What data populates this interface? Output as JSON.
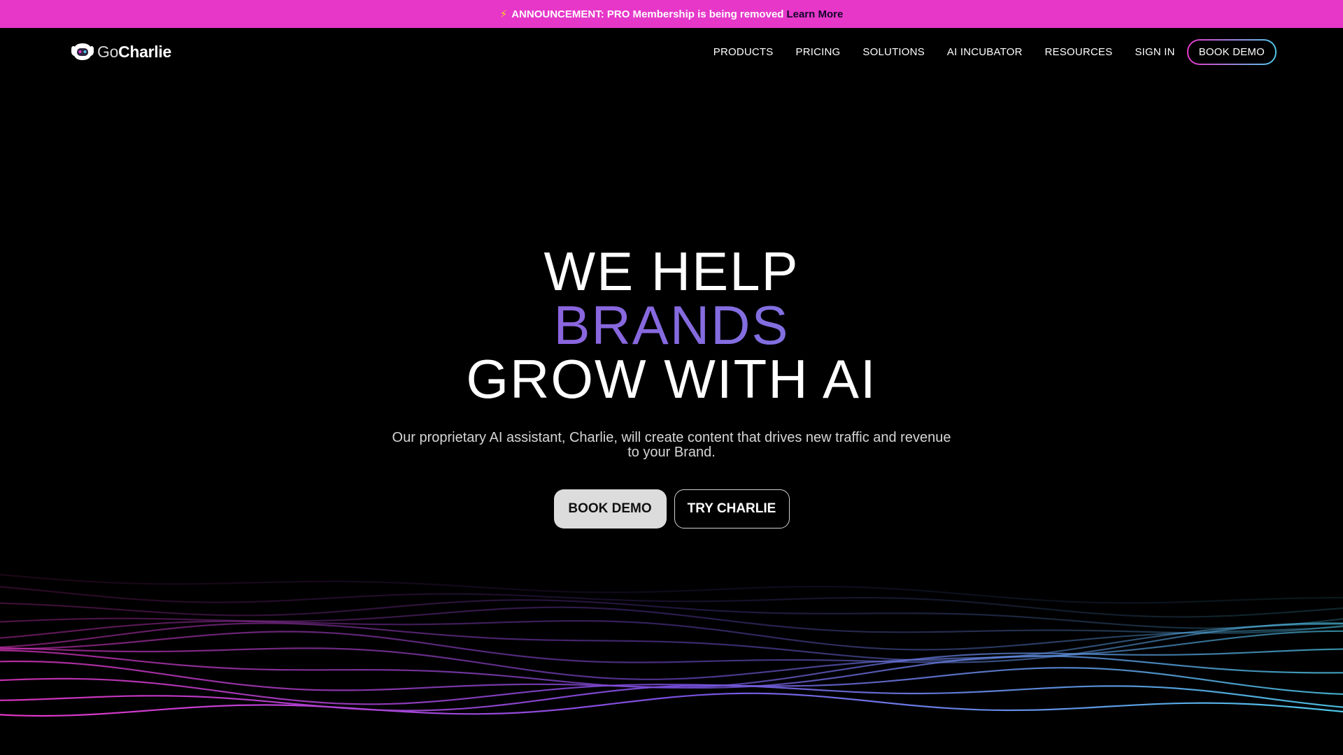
{
  "announcement": {
    "icon": "lightning-bolt-icon",
    "text": "ANNOUNCEMENT: PRO Membership is being removed",
    "link": "Learn More"
  },
  "logo": {
    "part1": "Go",
    "part2": "Charlie"
  },
  "nav": {
    "items": [
      "PRODUCTS",
      "PRICING",
      "SOLUTIONS",
      "AI INCUBATOR",
      "RESOURCES",
      "SIGN IN"
    ],
    "cta": "BOOK DEMO"
  },
  "hero": {
    "line1": "WE HELP",
    "line2": "BRANDS",
    "line3": "GROW WITH AI",
    "subtitle": "Our proprietary AI assistant, Charlie, will create content that drives new traffic and revenue to your Brand."
  },
  "buttons": {
    "primary": "BOOK DEMO",
    "secondary": "TRY CHARLIE"
  },
  "colors": {
    "announcement_bg": "#e637c9",
    "wave_start": "#e637c9",
    "wave_end": "#4fc8ea",
    "brands_gradient_start": "#a24bd8",
    "brands_gradient_end": "#6a89e6"
  }
}
